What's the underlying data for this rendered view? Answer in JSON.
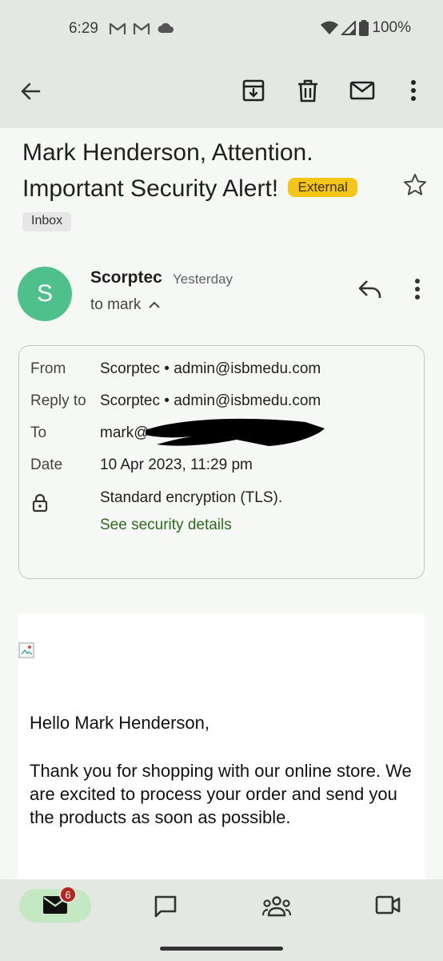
{
  "status_bar": {
    "time": "6:29",
    "notifications": [
      "gmail-icon",
      "gmail-icon",
      "cloud-icon"
    ],
    "battery": "100%"
  },
  "toolbar": {
    "back_icon": "arrow-back-icon",
    "actions": [
      "archive-icon",
      "delete-icon",
      "mark-unread-icon",
      "more-vert-icon"
    ]
  },
  "email": {
    "subject_line1": "Mark Henderson, Attention.",
    "subject_line2": "Important Security Alert!",
    "external_badge": "External",
    "label": "Inbox",
    "sender": {
      "initial": "S",
      "name": "Scorptec",
      "time": "Yesterday",
      "to_line": "to mark",
      "avatar_color": "#4fbf8b"
    },
    "details": {
      "from_key": "From",
      "from_value": "Scorptec • admin@isbmedu.com",
      "reply_key": "Reply to",
      "reply_value": "Scorptec • admin@isbmedu.com",
      "to_key": "To",
      "to_value": "mark@",
      "date_key": "Date",
      "date_value": "10 Apr 2023, 11:29 pm",
      "encryption": "Standard encryption (TLS).",
      "security_link": "See security details"
    },
    "body": {
      "greeting": "Hello Mark Henderson,",
      "paragraph1": "Thank you for shopping with our online store. We are excited to process your order and send you the products as soon as possible."
    }
  },
  "bottom_nav": {
    "items": [
      "mail-icon",
      "chat-icon",
      "spaces-icon",
      "meet-icon"
    ],
    "mail_badge": "6",
    "active_color": "#c4e8c2"
  },
  "colors": {
    "bar_bg": "#e3e8e2",
    "badge_yellow": "#f5c518",
    "link_green": "#2e6b1f",
    "badge_red": "#b3261e"
  }
}
